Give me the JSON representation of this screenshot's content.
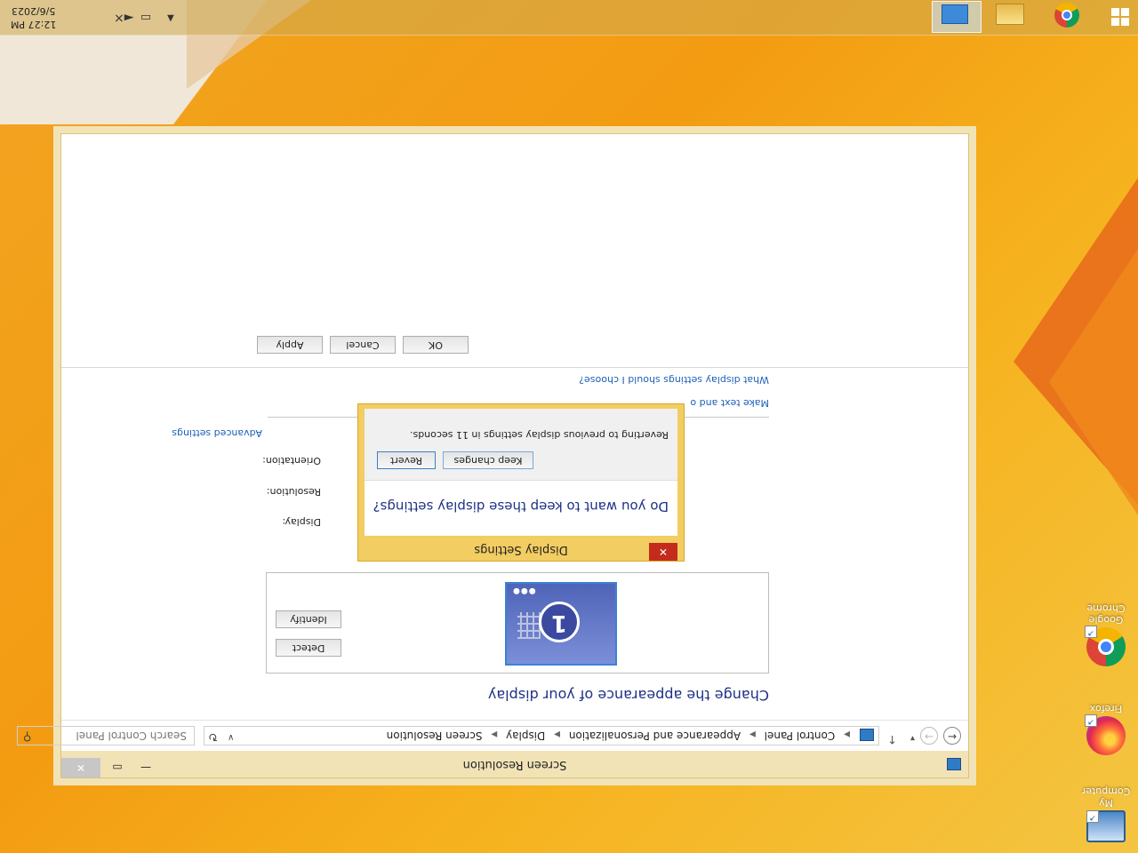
{
  "window": {
    "title": "Screen Resolution",
    "close_glyph": "✕",
    "max_glyph": "▭",
    "min_glyph": "—"
  },
  "address": {
    "crumbs": [
      "Control Panel",
      "Appearance and Personalization",
      "Display",
      "Screen Resolution"
    ],
    "search_placeholder": "Search Control Panel"
  },
  "main": {
    "heading": "Change the appearance of your display",
    "monitor_number": "1",
    "detect_label": "Detect",
    "identify_label": "Identify",
    "display_label": "Display:",
    "resolution_label": "Resolution:",
    "orientation_label": "Orientation:",
    "advanced_link": "Advanced settings",
    "link_text_size": "Make text and o",
    "link_help": "What display settings should I choose?",
    "ok_label": "OK",
    "cancel_label": "Cancel",
    "apply_label": "Apply"
  },
  "dialog": {
    "title": "Display Settings",
    "close_glyph": "✕",
    "question": "Do you want to keep these display settings?",
    "keep_label": "Keep changes",
    "revert_label": "Revert",
    "message": "Reverting to previous display settings in 11 seconds."
  },
  "desktop": {
    "icons": [
      {
        "label": "My Computer"
      },
      {
        "label": "Firefox"
      },
      {
        "label": "Google Chrome"
      }
    ]
  },
  "taskbar": {
    "time": "12:27 PM",
    "date": "5/6/2023"
  },
  "colors": {
    "accent": "#1e3287",
    "link": "#1c5fb8",
    "dialog_frame": "#f2cd62",
    "close_red": "#c42b1c"
  }
}
